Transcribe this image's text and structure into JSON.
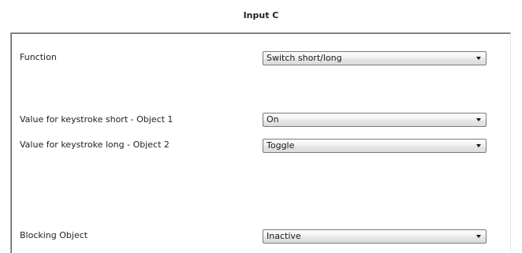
{
  "dialog": {
    "title": "Input C"
  },
  "rows": [
    {
      "label": "Function",
      "value": "Switch short/long",
      "icon": "chevron-down-icon"
    },
    {
      "label": "Value for keystroke short - Object 1",
      "value": "On",
      "icon": "chevron-down-icon"
    },
    {
      "label": "Value for keystroke long - Object 2",
      "value": "Toggle",
      "icon": "chevron-down-icon"
    },
    {
      "label": "Blocking Object",
      "value": "Inactive",
      "icon": "chevron-down-icon"
    }
  ]
}
